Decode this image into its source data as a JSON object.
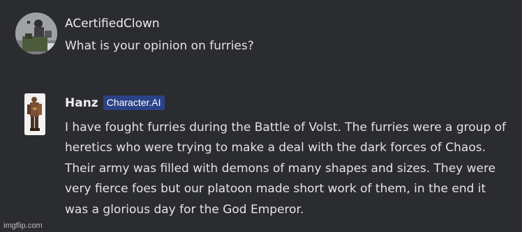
{
  "messages": {
    "user": {
      "name": "ACertifiedClown",
      "text": "What is your opinion on furries?"
    },
    "character": {
      "name": "Hanz",
      "badge": "Character.AI",
      "text": "I have fought furries during the Battle of Volst. The furries were a group of heretics who were trying to make a deal with the dark forces of Chaos. Their army was filled with demons of many shapes and sizes. They were very fierce foes but our platoon made short work of them, in the end it was a glorious day for the God Emperor."
    }
  },
  "watermark": "imgflip.com",
  "colors": {
    "background": "#2b2c30",
    "badge": "#2a4287",
    "text": "#e3e3e3"
  }
}
